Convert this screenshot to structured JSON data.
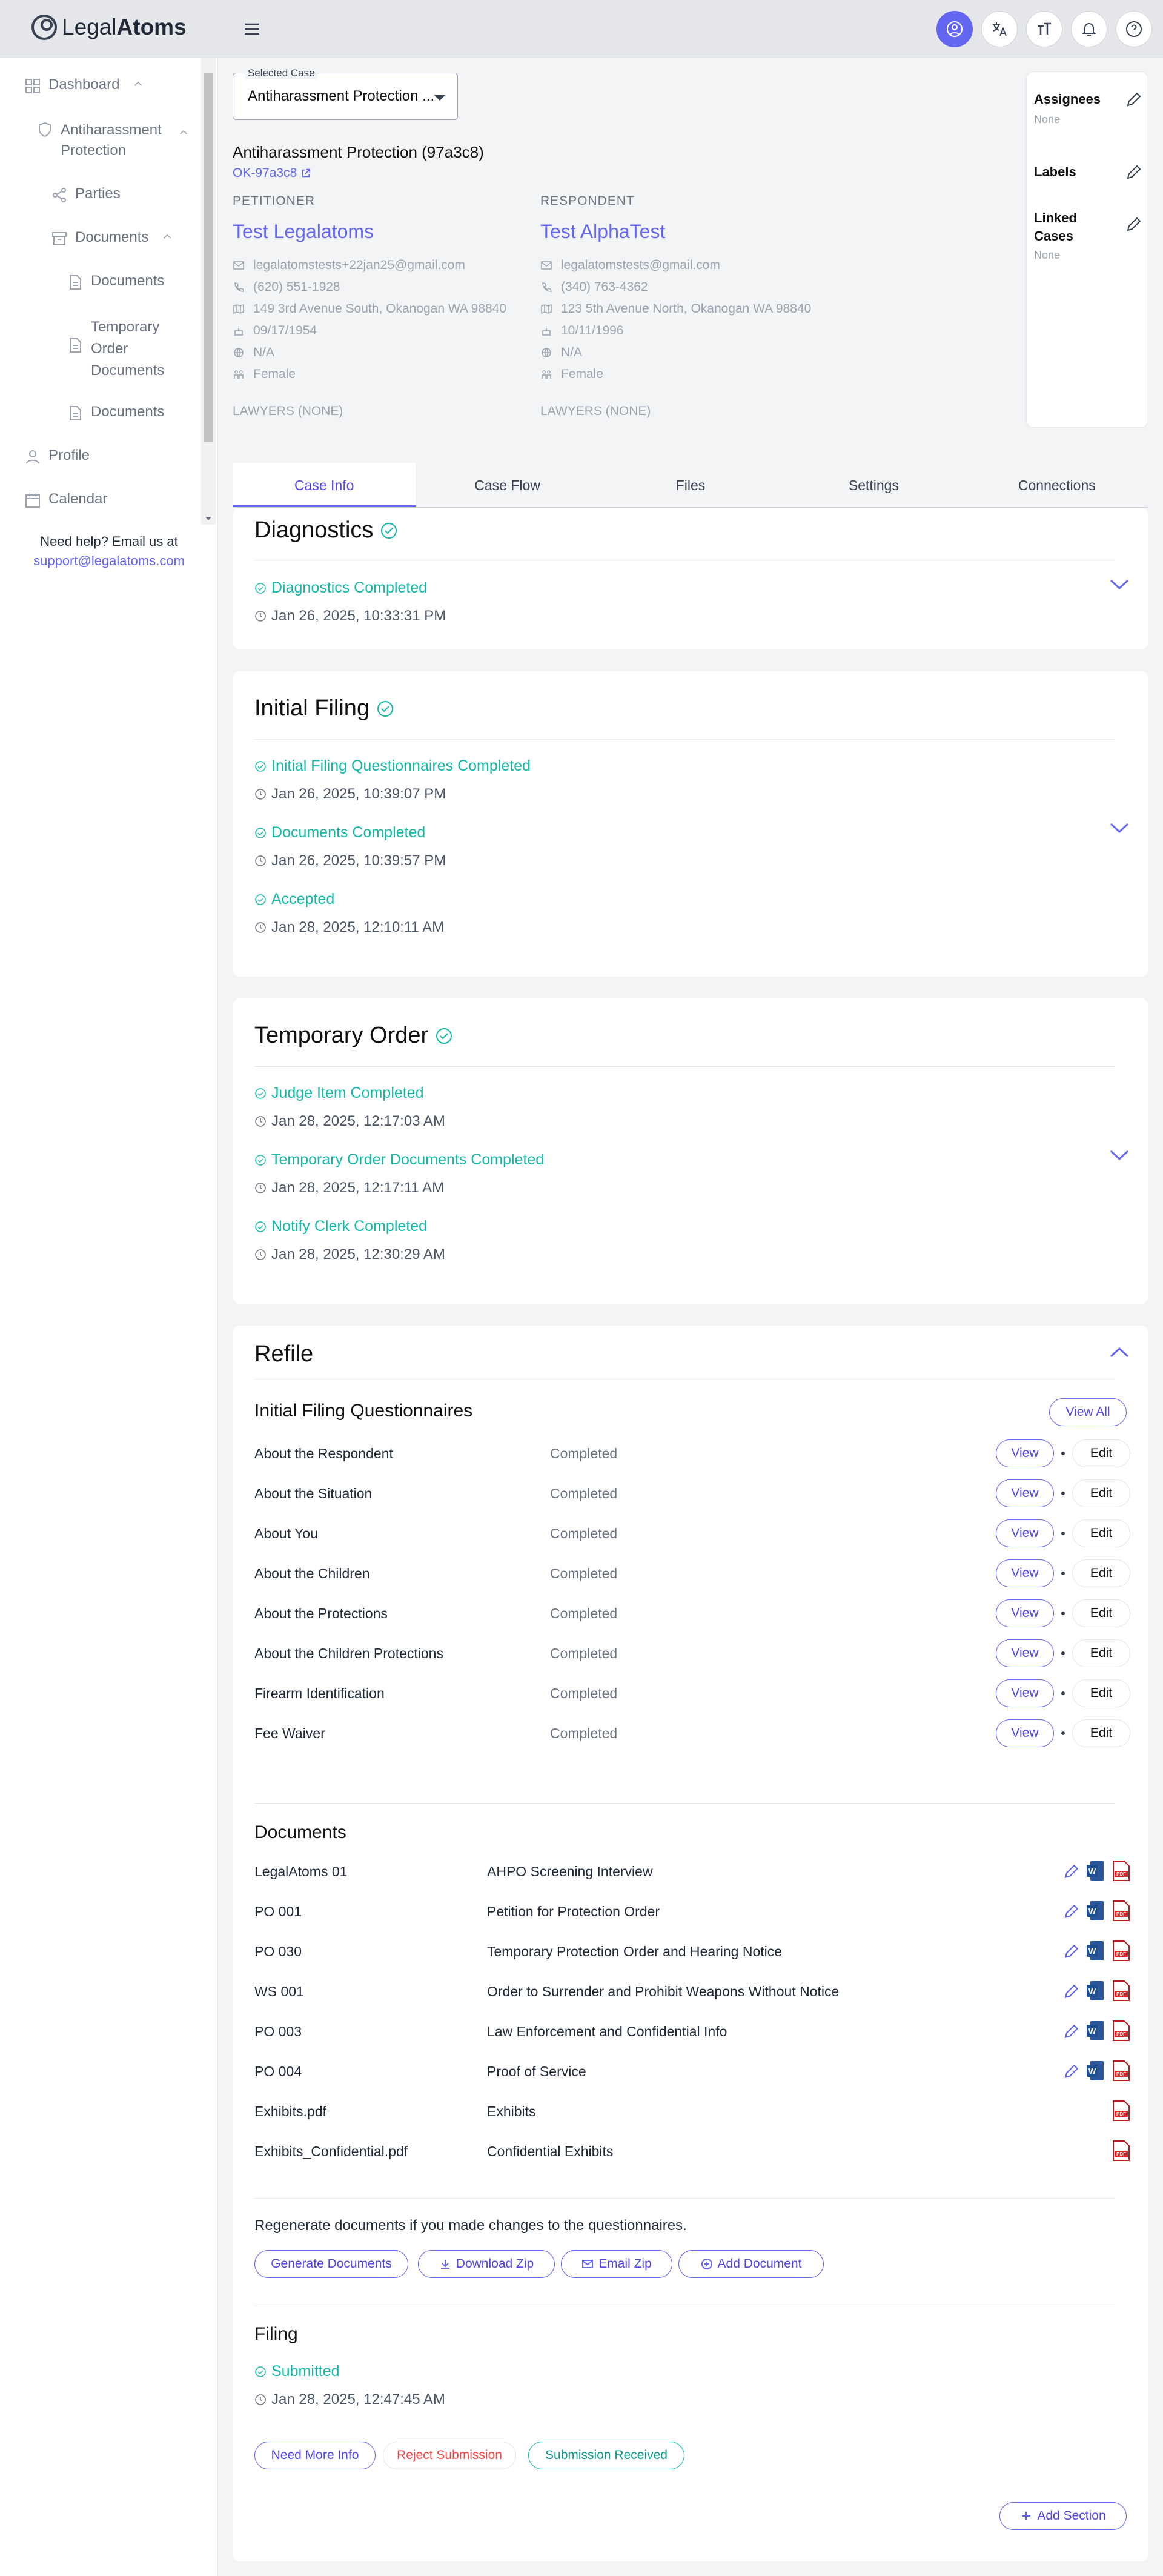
{
  "app": {
    "logo_light": "Legal",
    "logo_bold": "Atoms"
  },
  "sidebar": {
    "dashboard": "Dashboard",
    "case": "Antiharassment Protection",
    "parties": "Parties",
    "documents": "Documents",
    "documents_sub1": "Documents",
    "temp_order_docs": "Temporary Order Documents",
    "documents_sub2": "Documents",
    "profile": "Profile",
    "calendar": "Calendar",
    "help_text": "Need help? Email us at",
    "help_email": "support@legalatoms.com"
  },
  "selected_case": {
    "label": "Selected Case",
    "value": "Antiharassment Protection ..."
  },
  "case": {
    "title": "Antiharassment Protection (97a3c8)",
    "link": "OK-97a3c8"
  },
  "petitioner": {
    "role": "PETITIONER",
    "name": "Test Legalatoms",
    "email": "legalatomstests+22jan25@gmail.com",
    "phone": "(620) 551-1928",
    "address": "149 3rd Avenue South, Okanogan WA 98840",
    "dob": "09/17/1954",
    "other": "N/A",
    "gender": "Female",
    "lawyers": "LAWYERS (NONE)"
  },
  "respondent": {
    "role": "RESPONDENT",
    "name": "Test AlphaTest",
    "email": "legalatomstests@gmail.com",
    "phone": "(340) 763-4362",
    "address": "123 5th Avenue North, Okanogan WA 98840",
    "dob": "10/11/1996",
    "other": "N/A",
    "gender": "Female",
    "lawyers": "LAWYERS (NONE)"
  },
  "right_panel": {
    "assignees": "Assignees",
    "assignees_val": "None",
    "labels": "Labels",
    "linked": "Linked Cases",
    "linked_val": "None"
  },
  "tabs": [
    "Case Info",
    "Case Flow",
    "Files",
    "Settings",
    "Connections"
  ],
  "diagnostics": {
    "title": "Diagnostics",
    "items": [
      {
        "status": "Diagnostics Completed",
        "time": "Jan 26, 2025, 10:33:31 PM"
      }
    ]
  },
  "initial_filing": {
    "title": "Initial Filing",
    "items": [
      {
        "status": "Initial Filing Questionnaires Completed",
        "time": "Jan 26, 2025, 10:39:07 PM"
      },
      {
        "status": "Documents Completed",
        "time": "Jan 26, 2025, 10:39:57 PM"
      },
      {
        "status": "Accepted",
        "time": "Jan 28, 2025, 12:10:11 AM"
      }
    ]
  },
  "temporary_order": {
    "title": "Temporary Order",
    "items": [
      {
        "status": "Judge Item Completed",
        "time": "Jan 28, 2025, 12:17:03 AM"
      },
      {
        "status": "Temporary Order Documents Completed",
        "time": "Jan 28, 2025, 12:17:11 AM"
      },
      {
        "status": "Notify Clerk Completed",
        "time": "Jan 28, 2025, 12:30:29 AM"
      }
    ]
  },
  "refile": {
    "title": "Refile",
    "questionnaires_title": "Initial Filing Questionnaires",
    "view_all": "View All",
    "view": "View",
    "edit": "Edit",
    "questionnaires": [
      {
        "name": "About the Respondent",
        "status": "Completed"
      },
      {
        "name": "About the Situation",
        "status": "Completed"
      },
      {
        "name": "About You",
        "status": "Completed"
      },
      {
        "name": "About the Children",
        "status": "Completed"
      },
      {
        "name": "About the Protections",
        "status": "Completed"
      },
      {
        "name": "About the Children Protections",
        "status": "Completed"
      },
      {
        "name": "Firearm Identification",
        "status": "Completed"
      },
      {
        "name": "Fee Waiver",
        "status": "Completed"
      }
    ],
    "documents_title": "Documents",
    "documents": [
      {
        "code": "LegalAtoms 01",
        "name": "AHPO Screening Interview"
      },
      {
        "code": "PO 001",
        "name": "Petition for Protection Order"
      },
      {
        "code": "PO 030",
        "name": "Temporary Protection Order and Hearing Notice"
      },
      {
        "code": "WS 001",
        "name": "Order to Surrender and Prohibit Weapons Without Notice"
      },
      {
        "code": "PO 003",
        "name": "Law Enforcement and Confidential Info"
      },
      {
        "code": "PO 004",
        "name": "Proof of Service"
      },
      {
        "code": "Exhibits.pdf",
        "name": "Exhibits"
      },
      {
        "code": "Exhibits_Confidential.pdf",
        "name": "Confidential Exhibits"
      }
    ],
    "regen_text": "Regenerate documents if you made changes to the questionnaires.",
    "btn_generate": "Generate Documents",
    "btn_download": "Download Zip",
    "btn_email": "Email Zip",
    "btn_add_doc": "Add Document",
    "filing_title": "Filing",
    "filing_status": "Submitted",
    "filing_time": "Jan 28, 2025, 12:47:45 AM",
    "btn_more_info": "Need More Info",
    "btn_reject": "Reject Submission",
    "btn_received": "Submission Received",
    "btn_add_section": "Add Section"
  },
  "colors": {
    "accent": "#6366f1",
    "success": "#14b8a6",
    "danger": "#ef4444"
  }
}
